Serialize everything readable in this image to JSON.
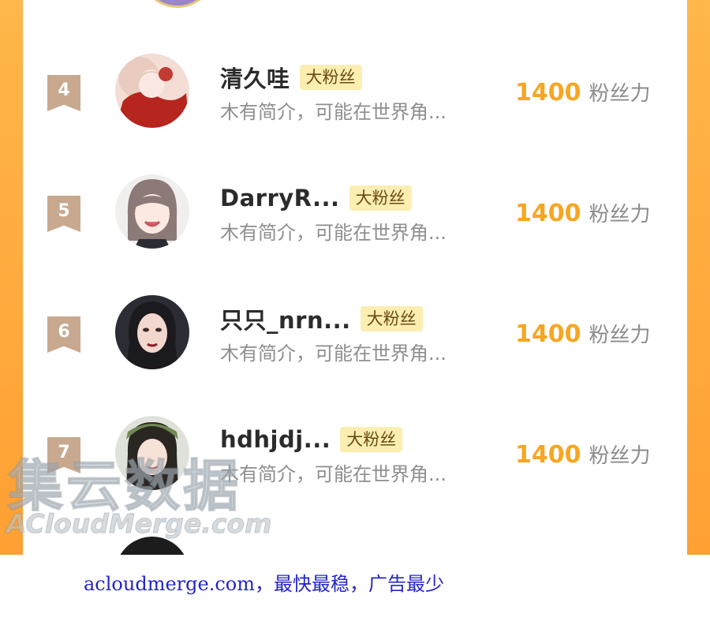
{
  "list": {
    "rows": [
      {
        "rank": "4",
        "name": "清久哇",
        "badge": "大粉丝",
        "bio": "木有简介，可能在世界角...",
        "score": "1400",
        "score_unit": "粉丝力"
      },
      {
        "rank": "5",
        "name": "DarryR...",
        "badge": "大粉丝",
        "bio": "木有简介，可能在世界角...",
        "score": "1400",
        "score_unit": "粉丝力"
      },
      {
        "rank": "6",
        "name": "只只_nrn...",
        "badge": "大粉丝",
        "bio": "木有简介，可能在世界角...",
        "score": "1400",
        "score_unit": "粉丝力"
      },
      {
        "rank": "7",
        "name": "hdhjdj...",
        "badge": "大粉丝",
        "bio": "木有简介，可能在世界角...",
        "score": "1400",
        "score_unit": "粉丝力"
      }
    ]
  },
  "watermark": {
    "cn": "集云数据",
    "en": "ACloudMerge.com"
  },
  "caption": "acloudmerge.com，最快最稳，广告最少",
  "colors": {
    "accent": "#f5a623",
    "frame": "#ffa53a",
    "badge_bg": "#fbeeb0",
    "rank_tag": "#c8a98f",
    "caption": "#2424c8"
  }
}
